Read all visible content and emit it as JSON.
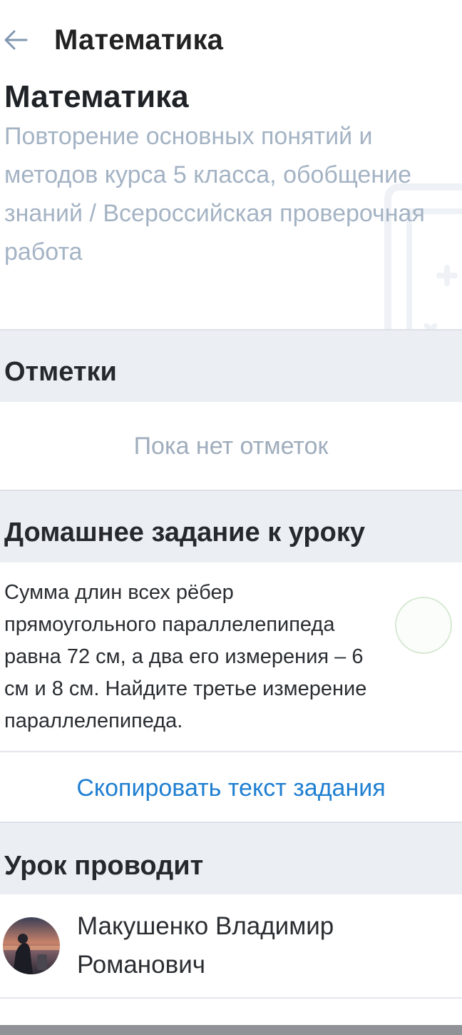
{
  "topbar": {
    "back_icon": "arrow-left-icon",
    "title": "Математика"
  },
  "lesson": {
    "title": "Математика",
    "topic": "Повторение основных понятий и методов курса 5 класса, обобщение знаний / Всероссийская проверочная работа",
    "decor_icon": "calculator-icon"
  },
  "marks": {
    "heading": "Отметки",
    "empty_text": "Пока нет отметок"
  },
  "homework": {
    "heading": "Домашнее задание к уроку",
    "text": "Сумма длин всех рёбер прямоугольного параллелепипеда равна 72 см, а два его измерения – 6 см и 8 см. Найдите третье измерение параллелепипеда.",
    "done": false,
    "copy_label": "Скопировать текст задания"
  },
  "teacher": {
    "heading": "Урок проводит",
    "name": "Макушенко Владимир Романович"
  },
  "colors": {
    "accent": "#1f7fd1",
    "muted_text": "#a4b3c4",
    "section_bg": "#ebeef3",
    "check_border": "#d7e9d3"
  }
}
